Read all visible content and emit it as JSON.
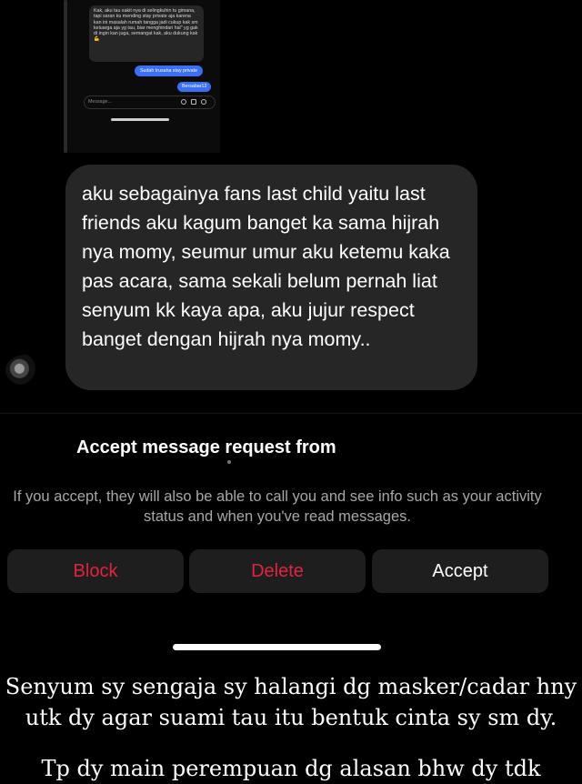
{
  "mini_screenshot": {
    "received_message": "Kak, aku tau sakit nya di selingkuhin tu gimana, tapi saran ku mending stay private aja karena kan ini masalah rumah tangga jadi cukup kak sm keluarga aja yg tau, biar menghindari hal\" yg gak di ingin kan juga, semangat kak, aku dukung kak 💪",
    "sent_message_1": "Sudah trusaha stay private",
    "sent_message_2": "Bersabar12",
    "input_placeholder": "Message..."
  },
  "message": {
    "text": "aku sebagainya fans last child yaitu last friends aku kagum banget ka sama hijrah nya momy, seumur umur aku ketemu kaka pas acara, sama sekali belum pernah liat senyum kk kaya apa, aku jujur respect banget dengan hijrah nya momy.."
  },
  "request_sheet": {
    "title": "Accept message request from",
    "description": "If you accept, they will also be able to call you and see info such as your activity status and when you've read messages.",
    "buttons": {
      "block": "Block",
      "delete": "Delete",
      "accept": "Accept"
    }
  },
  "caption": {
    "line1": "Senyum sy sengaja sy halangi dg masker/cadar hny utk dy agar suami tau itu bentuk cinta sy sm dy.",
    "line2": "Tp dy main perempuan dg alasan bhw dy tdk"
  },
  "colors": {
    "background": "#000000",
    "bubble": "#262626",
    "destructive": "#e0243f",
    "sent_bubble": "#3b6ff5"
  }
}
